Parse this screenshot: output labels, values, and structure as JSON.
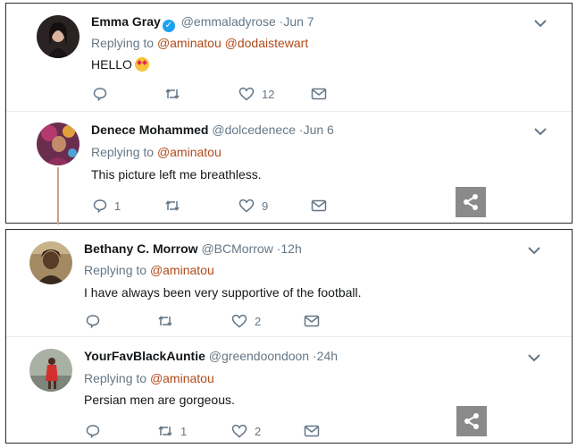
{
  "tweets": [
    {
      "name": "Emma Gray",
      "verified": true,
      "handle": "@emmaladyrose",
      "dot": "·",
      "time": "Jun 7",
      "replying_prefix": "Replying to",
      "mentions": [
        "@aminatou",
        "@dodaistewart"
      ],
      "text": "HELLO",
      "emoji": "star-struck-emoji",
      "reply_count": "",
      "retweet_count": "",
      "like_count": "12"
    },
    {
      "name": "Denece Mohammed",
      "verified": false,
      "handle": "@dolcedenece",
      "dot": "·",
      "time": "Jun 6",
      "replying_prefix": "Replying to",
      "mentions": [
        "@aminatou"
      ],
      "text": "This picture left me breathless.",
      "reply_count": "1",
      "retweet_count": "",
      "like_count": "9"
    },
    {
      "name": "Bethany C. Morrow",
      "verified": false,
      "handle": "@BCMorrow",
      "dot": "·",
      "time": "12h",
      "replying_prefix": "Replying to",
      "mentions": [
        "@aminatou"
      ],
      "text": "I have always been very supportive of the football.",
      "reply_count": "",
      "retweet_count": "",
      "like_count": "2"
    },
    {
      "name": "YourFavBlackAuntie",
      "verified": false,
      "handle": "@greendoondoon",
      "dot": "·",
      "time": "24h",
      "replying_prefix": "Replying to",
      "mentions": [
        "@aminatou"
      ],
      "text": "Persian men are gorgeous.",
      "reply_count": "",
      "retweet_count": "1",
      "like_count": "2"
    }
  ],
  "icons": {
    "reply": "reply-icon",
    "retweet": "retweet-icon",
    "like": "heart-icon",
    "dm": "envelope-icon",
    "more": "chevron-down-icon",
    "share": "share-icon",
    "verified": "verified-badge-icon"
  },
  "colors": {
    "mention": "#b04a18",
    "secondary_text": "#657786",
    "verified": "#1da1f2",
    "share_button": "#8a8a8a"
  }
}
